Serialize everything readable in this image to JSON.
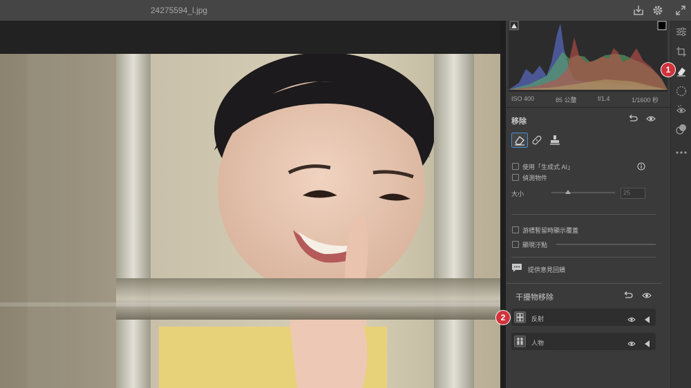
{
  "window": {
    "title": "24275594_l.jpg"
  },
  "exif": {
    "iso": "ISO 400",
    "focal": "85 公釐",
    "aperture": "f/1.4",
    "shutter": "1/1600 秒"
  },
  "remove_panel": {
    "title": "移除",
    "use_generative_ai": "使用「生成式 AI」",
    "detect_objects": "偵測物件",
    "size_label": "大小",
    "size_value": "25",
    "show_overlay": "游標暫留時顯示覆蓋",
    "visualize_spots": "顯現汙點",
    "feedback": "提供意見回饋"
  },
  "distraction_panel": {
    "title": "干擾物移除",
    "items": [
      {
        "label": "反射",
        "icon": "reflection-icon"
      },
      {
        "label": "人物",
        "icon": "people-icon"
      }
    ]
  },
  "badges": {
    "one": "1",
    "two": "2"
  },
  "toolstrip_icons": [
    "sliders-icon",
    "crop-icon",
    "eraser-icon",
    "mask-icon",
    "redeye-icon",
    "presets-icon",
    "more-icon"
  ]
}
